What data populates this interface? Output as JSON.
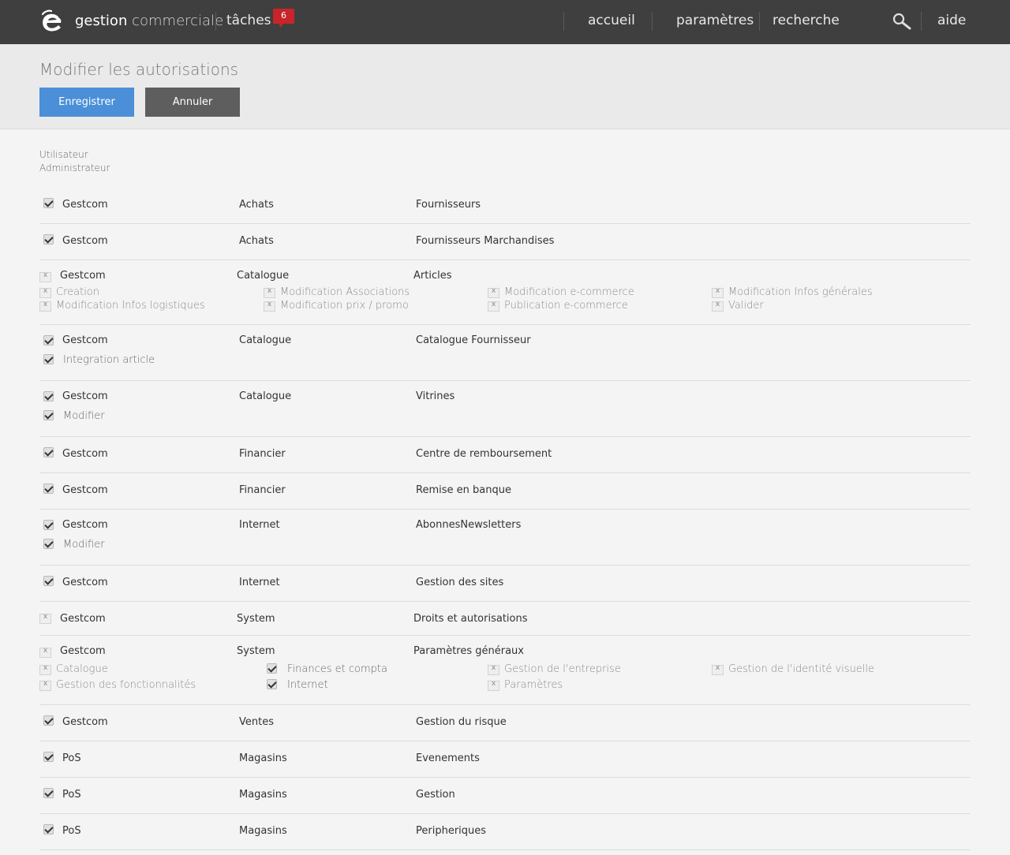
{
  "topbar": {
    "brand_main": "gestion",
    "brand_sub": "commerciale",
    "tasks_label": "tâches",
    "tasks_count": "6",
    "nav": {
      "home": "accueil",
      "settings": "paramètres",
      "search": "recherche",
      "help": "aide"
    },
    "icons": {
      "logo": "e-logo-icon",
      "search": "magnifier-icon"
    }
  },
  "header": {
    "title": "Modifier les autorisations",
    "save_label": "Enregistrer",
    "cancel_label": "Annuler"
  },
  "user": {
    "label": "Utilisateur",
    "value": "Administrateur"
  },
  "rows": [
    {
      "checked": true,
      "app": "Gestcom",
      "module": "Achats",
      "feature": "Fournisseurs",
      "subs": []
    },
    {
      "checked": true,
      "app": "Gestcom",
      "module": "Achats",
      "feature": "Fournisseurs Marchandises",
      "subs": []
    },
    {
      "checked": false,
      "app": "Gestcom",
      "module": "Catalogue",
      "feature": "Articles",
      "subs": [
        {
          "checked": false,
          "label": "Creation"
        },
        {
          "checked": false,
          "label": "Modification Associations"
        },
        {
          "checked": false,
          "label": "Modification e-commerce"
        },
        {
          "checked": false,
          "label": "Modification Infos générales"
        },
        {
          "checked": false,
          "label": "Modification Infos logistiques"
        },
        {
          "checked": false,
          "label": "Modification prix / promo"
        },
        {
          "checked": false,
          "label": "Publication e-commerce"
        },
        {
          "checked": false,
          "label": "Valider"
        }
      ]
    },
    {
      "checked": true,
      "app": "Gestcom",
      "module": "Catalogue",
      "feature": "Catalogue Fournisseur",
      "subs": [
        {
          "checked": true,
          "label": "Integration article"
        }
      ]
    },
    {
      "checked": true,
      "app": "Gestcom",
      "module": "Catalogue",
      "feature": "Vitrines",
      "subs": [
        {
          "checked": true,
          "label": "Modifier"
        }
      ]
    },
    {
      "checked": true,
      "app": "Gestcom",
      "module": "Financier",
      "feature": "Centre de remboursement",
      "subs": []
    },
    {
      "checked": true,
      "app": "Gestcom",
      "module": "Financier",
      "feature": "Remise en banque",
      "subs": []
    },
    {
      "checked": true,
      "app": "Gestcom",
      "module": "Internet",
      "feature": "AbonnesNewsletters",
      "subs": [
        {
          "checked": true,
          "label": "Modifier"
        }
      ]
    },
    {
      "checked": true,
      "app": "Gestcom",
      "module": "Internet",
      "feature": "Gestion des sites",
      "subs": []
    },
    {
      "checked": false,
      "app": "Gestcom",
      "module": "System",
      "feature": "Droits et autorisations",
      "subs": []
    },
    {
      "checked": false,
      "app": "Gestcom",
      "module": "System",
      "feature": "Paramètres généraux",
      "subs": [
        {
          "checked": false,
          "label": "Catalogue"
        },
        {
          "checked": true,
          "label": "Finances et compta"
        },
        {
          "checked": false,
          "label": "Gestion de l'entreprise"
        },
        {
          "checked": false,
          "label": "Gestion de l'identité visuelle"
        },
        {
          "checked": false,
          "label": "Gestion des fonctionnalités"
        },
        {
          "checked": true,
          "label": "Internet"
        },
        {
          "checked": false,
          "label": "Paramètres"
        }
      ]
    },
    {
      "checked": true,
      "app": "Gestcom",
      "module": "Ventes",
      "feature": "Gestion du risque",
      "subs": []
    },
    {
      "checked": true,
      "app": "PoS",
      "module": "Magasins",
      "feature": "Evenements",
      "subs": []
    },
    {
      "checked": true,
      "app": "PoS",
      "module": "Magasins",
      "feature": "Gestion",
      "subs": []
    },
    {
      "checked": true,
      "app": "PoS",
      "module": "Magasins",
      "feature": "Peripheriques",
      "subs": []
    }
  ]
}
